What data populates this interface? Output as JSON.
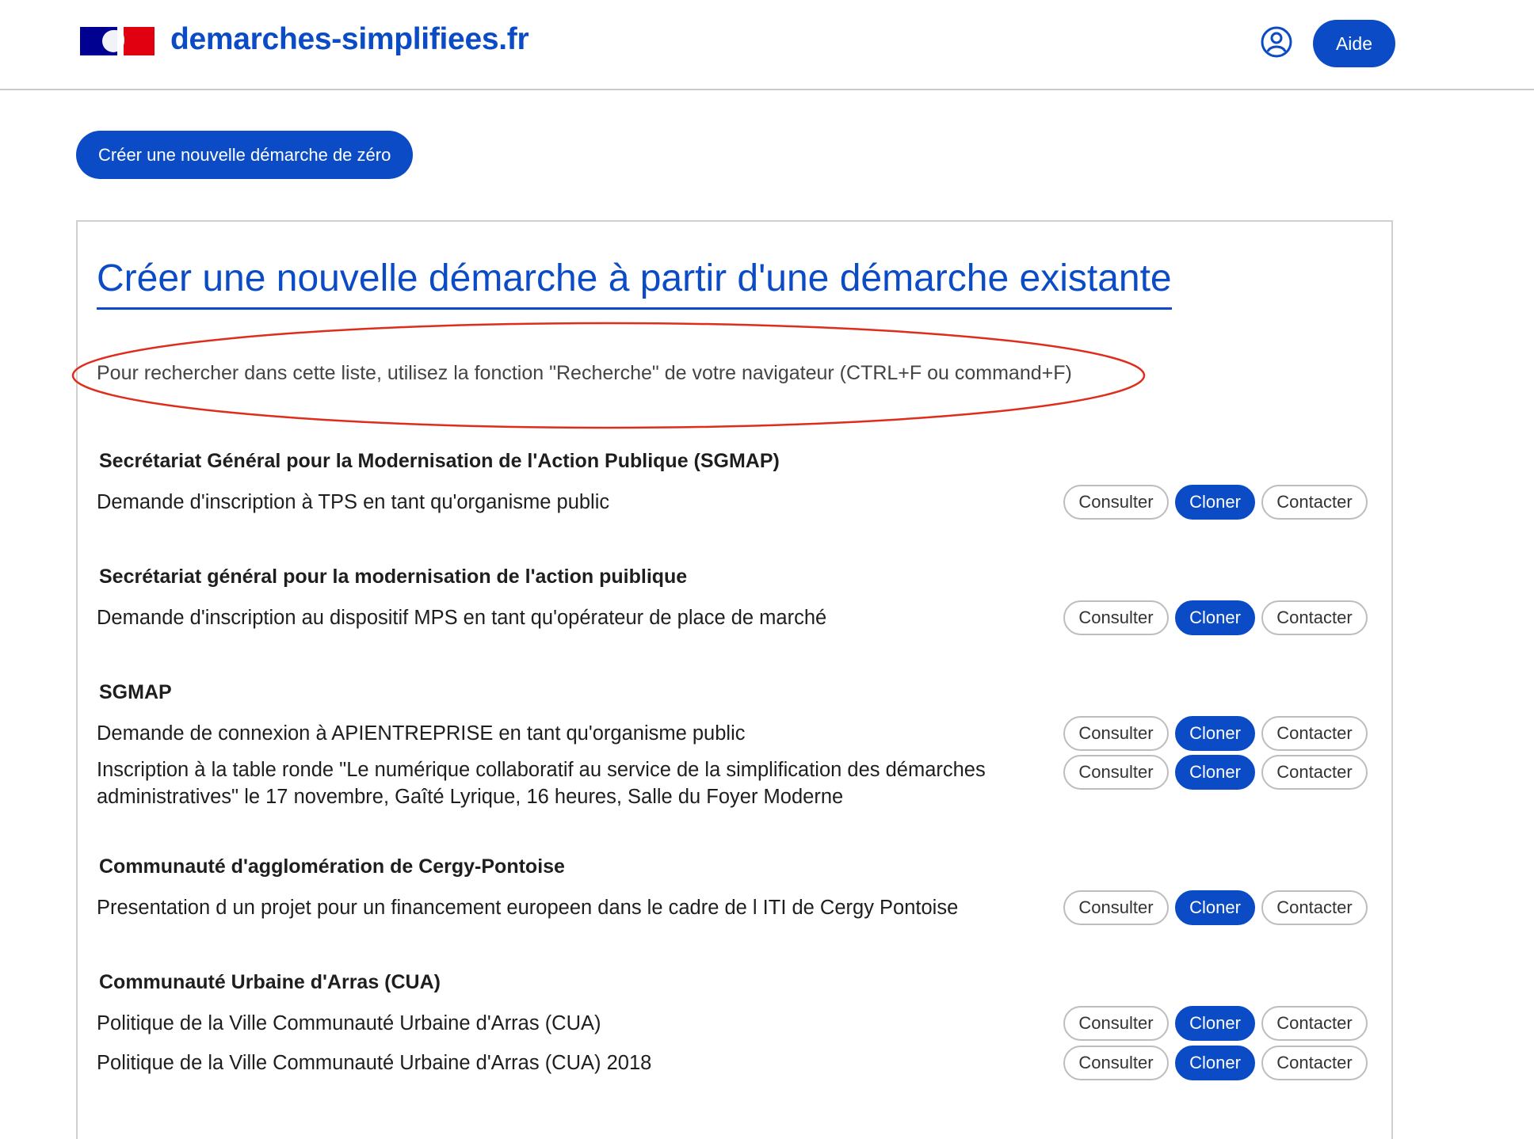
{
  "header": {
    "site_name": "demarches-simplifiees.fr",
    "help_label": "Aide",
    "logo_icon": "republique-francaise-logo",
    "user_icon": "user-circle-icon"
  },
  "create_button_label": "Créer une nouvelle démarche de zéro",
  "section": {
    "title": "Créer une nouvelle démarche à partir d'une démarche existante",
    "hint": "Pour rechercher dans cette liste, utilisez la fonction \"Recherche\" de votre navigateur (CTRL+F ou command+F)"
  },
  "actions": {
    "consulter": "Consulter",
    "cloner": "Cloner",
    "contacter": "Contacter"
  },
  "organizations": [
    {
      "name": "Secrétariat Général pour la Modernisation de l'Action Publique (SGMAP)",
      "procedures": [
        "Demande d'inscription à TPS en tant qu'organisme public"
      ]
    },
    {
      "name": "Secrétariat général pour la modernisation de l'action puiblique",
      "procedures": [
        "Demande d'inscription au dispositif MPS en tant qu'opérateur de place de marché"
      ]
    },
    {
      "name": "SGMAP",
      "procedures": [
        "Demande de connexion à APIENTREPRISE en tant qu'organisme public",
        "Inscription à la table ronde \"Le numérique collaboratif au service de la simplification des démarches administratives\" le 17 novembre, Gaîté Lyrique, 16 heures, Salle du Foyer Moderne"
      ]
    },
    {
      "name": "Communauté d'agglomération de Cergy-Pontoise",
      "procedures": [
        "Presentation d un projet pour un financement europeen dans le cadre de l ITI de Cergy Pontoise"
      ]
    },
    {
      "name": "Communauté Urbaine d'Arras (CUA)",
      "procedures": [
        "Politique de la Ville Communauté Urbaine d'Arras (CUA)",
        "Politique de la Ville Communauté Urbaine d'Arras (CUA) 2018"
      ]
    }
  ],
  "colors": {
    "primary": "#0b4bc5",
    "annotation": "#e02d1b"
  }
}
